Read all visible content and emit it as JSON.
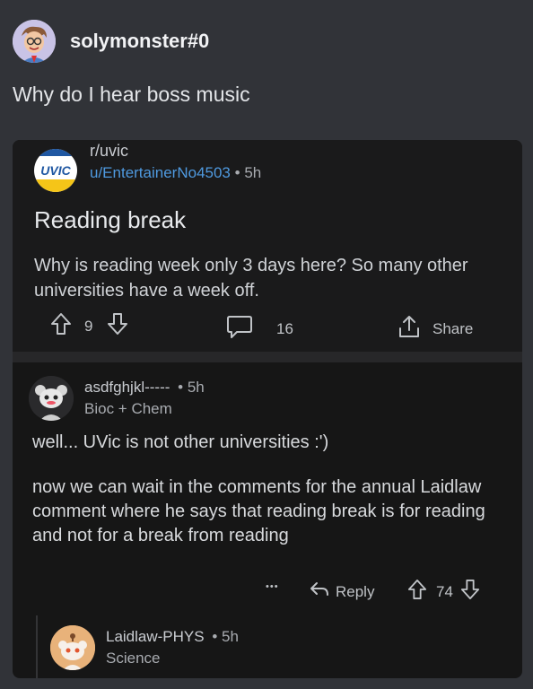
{
  "message": {
    "username": "solymonster#0",
    "text": "Why do I hear boss music"
  },
  "embed": {
    "subreddit": "r/uvic",
    "logo_text": "UVIC",
    "author": "u/EntertainerNo4503",
    "separator": "•",
    "age": "5h",
    "title": "Reading break",
    "body": "Why is reading week only 3 days here? So many other universities have a week off.",
    "upvotes": "9",
    "comments": "16",
    "share_label": "Share"
  },
  "comment": {
    "author": "asdfghjkl-----",
    "separator": "•",
    "age": "5h",
    "flair": "Bioc + Chem",
    "body_1": "well... UVic is not other universities :')",
    "body_2": "now we can wait in the comments for the annual Laidlaw comment where he says that reading break is for reading and not for a break from reading",
    "more": "•••",
    "reply_label": "Reply",
    "score": "74"
  },
  "reply": {
    "author": "Laidlaw-PHYS",
    "separator": "•",
    "age": "5h",
    "flair": "Science"
  },
  "colors": {
    "background": "#313338",
    "embed_background": "#1a1a1b",
    "link": "#4f9ae0",
    "uvic_blue": "#1f57a2",
    "uvic_yellow": "#f5c518"
  }
}
